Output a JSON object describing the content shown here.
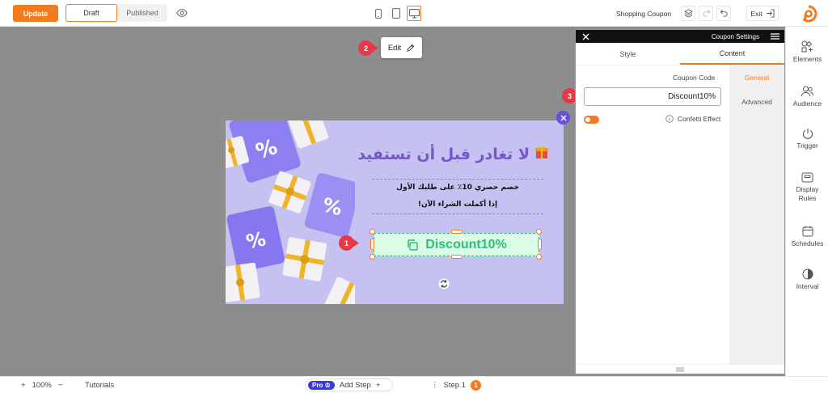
{
  "topbar": {
    "update_label": "Update",
    "draft_label": "Draft",
    "published_label": "Published",
    "campaign_name": "Shopping Coupon",
    "exit_label": "Exit"
  },
  "canvas": {
    "edit_label": "Edit",
    "popup": {
      "title": "لا تغادر قبل أن تستفيد",
      "line1": "خصم حصري 10٪ على طلبك الأول",
      "line2": "إذا أكملت الشراء الآن!",
      "coupon_text": "Discount10%"
    },
    "markers": [
      "1",
      "2",
      "3"
    ]
  },
  "panel": {
    "title": "Coupon Settings",
    "tabs": [
      "Style",
      "Content"
    ],
    "nav": [
      "General",
      "Advanced"
    ],
    "coupon_code_label": "Coupon Code",
    "coupon_code_value": "Discount10%",
    "confetti_label": "Confetti Effect"
  },
  "rail": {
    "items": [
      "Elements",
      "Audience",
      "Trigger",
      "Display Rules",
      "Schedules",
      "Interval"
    ]
  },
  "bottombar": {
    "zoom": "100%",
    "tutorials_label": "Tutorials",
    "pro_label": "Pro",
    "add_step_label": "Add Step",
    "step_label": "Step 1",
    "step_count": "1"
  },
  "colors": {
    "accent": "#f47a20",
    "popup_bg": "#c5c2f1",
    "title_purple": "#7458c8",
    "coupon_green": "#2dbf75",
    "marker_red": "#e63946"
  }
}
